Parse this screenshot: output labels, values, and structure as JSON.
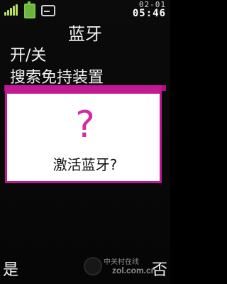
{
  "status": {
    "date": "02-01",
    "time": "05:46",
    "icons": [
      "signal-icon",
      "battery-icon",
      "message-icon"
    ]
  },
  "header": {
    "title": "蓝牙"
  },
  "menu": {
    "items": [
      {
        "label": "开/关"
      },
      {
        "label": "搜索免持装置"
      }
    ]
  },
  "dialog": {
    "icon": "question-icon",
    "icon_glyph": "?",
    "message": "激活蓝牙?"
  },
  "softkeys": {
    "left": "是",
    "right": "否"
  },
  "watermark": {
    "line1": "中关村在线",
    "line2": "zol.com.cn"
  },
  "colors": {
    "accent": "#c41596",
    "question": "#d42ca8",
    "battery": "#6db33f",
    "background": "#000000"
  }
}
